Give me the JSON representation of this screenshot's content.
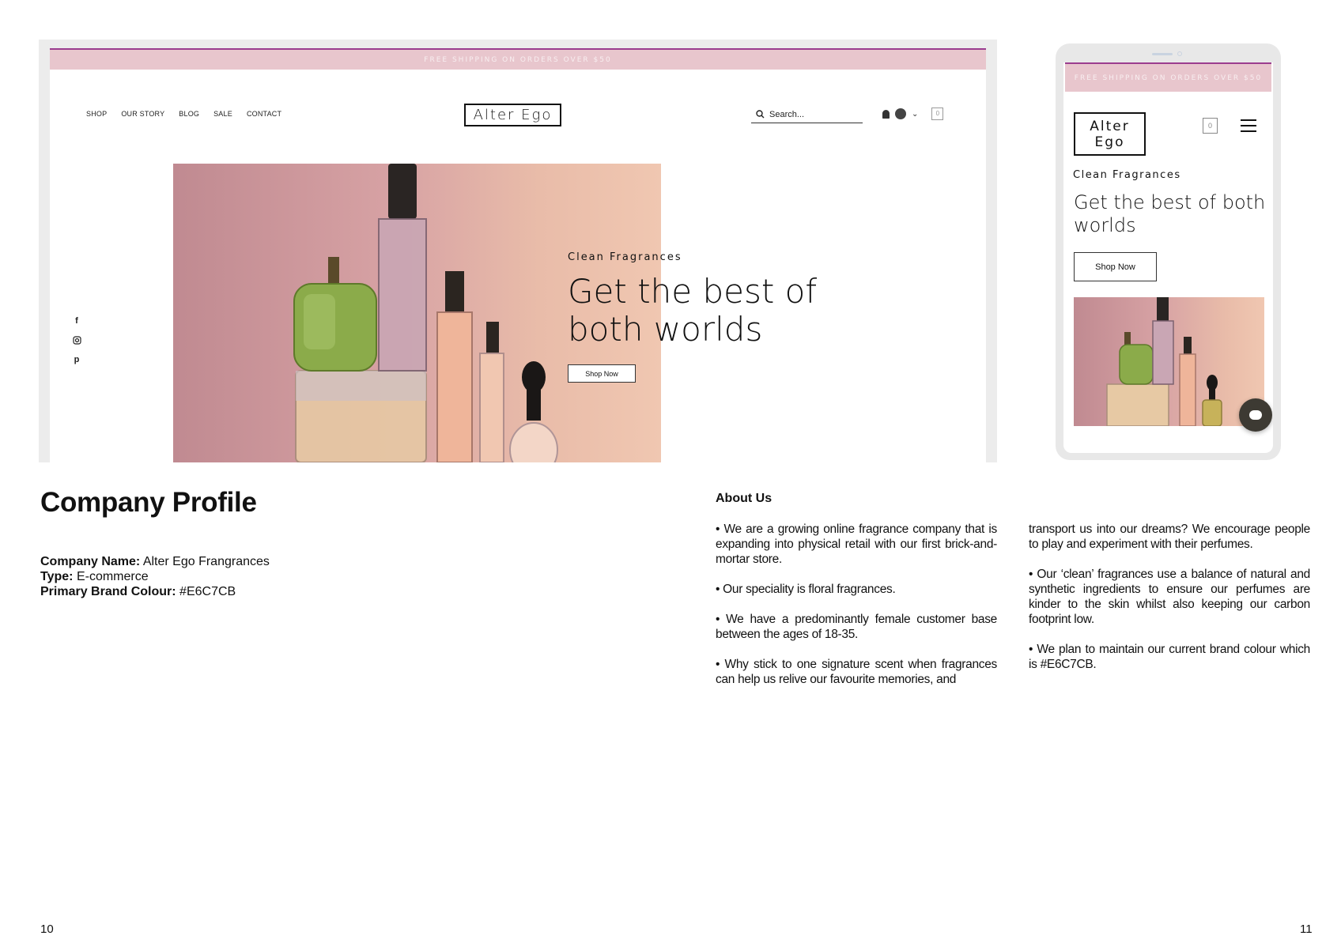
{
  "desktop": {
    "banner": "FREE SHIPPING ON ORDERS OVER $50",
    "nav": [
      "SHOP",
      "OUR STORY",
      "BLOG",
      "SALE",
      "CONTACT"
    ],
    "logo": "Alter Ego",
    "search_placeholder": "Search...",
    "cart_count": "0",
    "hero": {
      "eyebrow": "Clean Fragrances",
      "headline": "Get the best of both worlds",
      "button": "Shop Now"
    }
  },
  "mobile": {
    "banner": "FREE SHIPPING ON ORDERS OVER $50",
    "logo_line1": "Alter",
    "logo_line2": "Ego",
    "cart_count": "0",
    "eyebrow": "Clean Fragrances",
    "headline": "Get the best of both worlds",
    "button": "Shop Now"
  },
  "profile": {
    "title": "Company Profile",
    "name_label": "Company Name:",
    "name_value": "Alter Ego Frangrances",
    "type_label": "Type:",
    "type_value": "E-commerce",
    "colour_label": "Primary Brand Colour:",
    "colour_value": "#E6C7CB"
  },
  "about": {
    "title": "About Us",
    "col1": [
      "• We are a growing online fragrance company that is expanding into physical retail with our first brick-and-mortar store.",
      "• Our speciality is floral fragrances.",
      "• We have a predominantly female customer base between the ages of 18-35.",
      "• Why stick to one signature scent when fragrances can help us relive our favourite memories, and"
    ],
    "col2": [
      "transport us into our dreams? We encourage people to play and experiment with their perfumes.",
      "• Our ‘clean’ fragrances use a balance of natural and synthetic ingredients to ensure our perfumes are kinder to the skin whilst also keeping our carbon footprint low.",
      "• We plan to maintain our current brand colour which is #E6C7CB."
    ]
  },
  "page_numbers": {
    "left": "10",
    "right": "11"
  },
  "colors": {
    "brand_pink": "#E6C7CB",
    "banner_accent": "#9b3d8f"
  }
}
